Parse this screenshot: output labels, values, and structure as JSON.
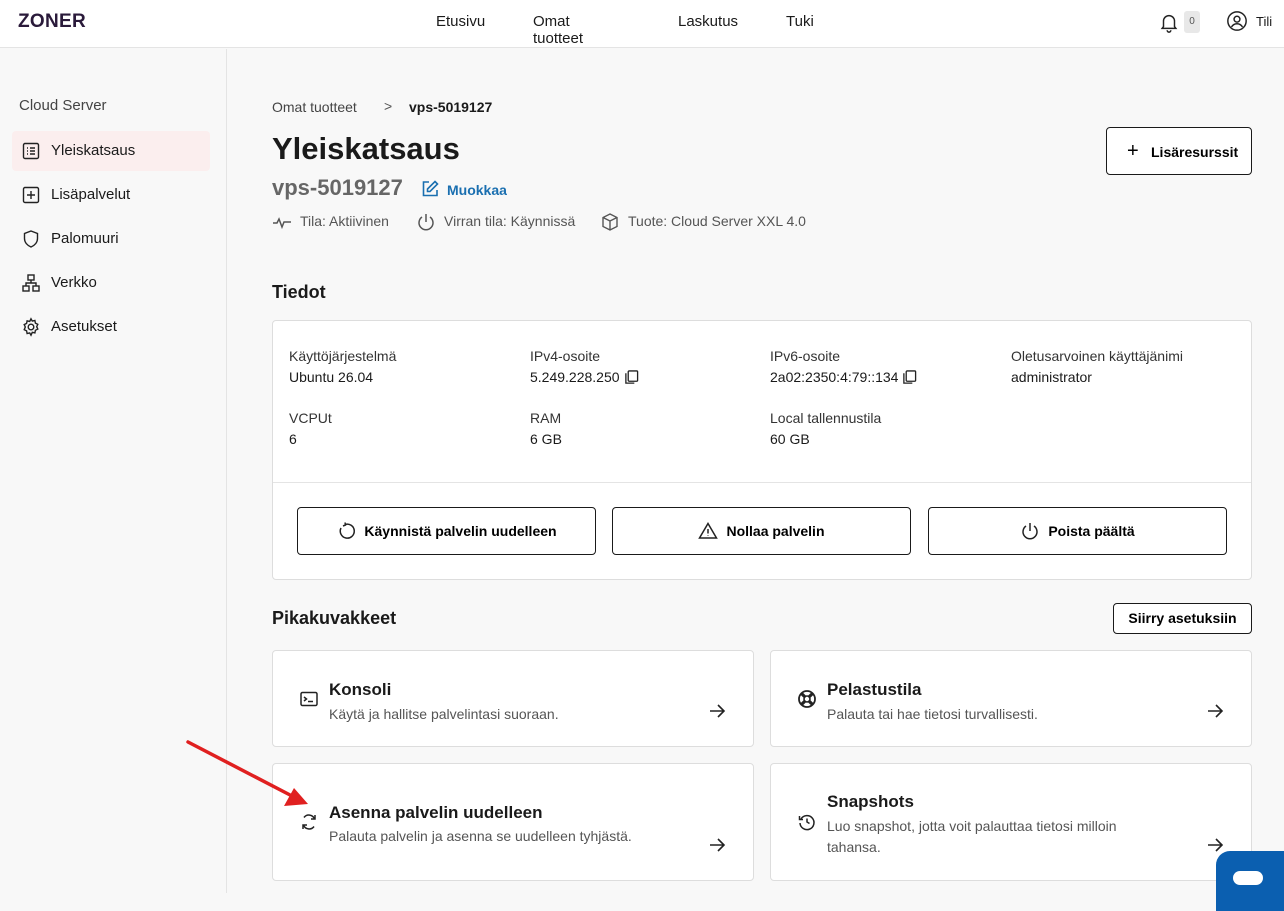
{
  "header": {
    "logo": "ZONER",
    "nav": [
      "Etusivu",
      "Omat tuotteet",
      "Laskutus",
      "Tuki"
    ],
    "notification_count": "0",
    "account_label": "Tili"
  },
  "sidebar": {
    "title": "Cloud Server",
    "items": [
      {
        "label": "Yleiskatsaus",
        "icon": "overview-list-icon",
        "active": true
      },
      {
        "label": "Lisäpalvelut",
        "icon": "plus-square-icon",
        "active": false
      },
      {
        "label": "Palomuuri",
        "icon": "shield-icon",
        "active": false
      },
      {
        "label": "Verkko",
        "icon": "network-icon",
        "active": false
      },
      {
        "label": "Asetukset",
        "icon": "gear-icon",
        "active": false
      }
    ]
  },
  "breadcrumb": {
    "parent": "Omat tuotteet",
    "separator": ">",
    "current": "vps-5019127"
  },
  "page": {
    "title": "Yleiskatsaus",
    "server_name": "vps-5019127",
    "edit_label": "Muokkaa",
    "status": {
      "state": "Tila: Aktiivinen",
      "power": "Virran tila: Käynnissä",
      "product": "Tuote: Cloud Server XXL 4.0"
    },
    "add_resources_label": "Lisäresurssit"
  },
  "details": {
    "heading": "Tiedot",
    "fields": [
      {
        "key": "Käyttöjärjestelmä",
        "value": "Ubuntu 26.04",
        "copy": false
      },
      {
        "key": "IPv4-osoite",
        "value": "5.249.228.250",
        "copy": true
      },
      {
        "key": "IPv6-osoite",
        "value": "2a02:2350:4:79::134",
        "copy": true
      },
      {
        "key": "Oletusarvoinen käyttäjänimi",
        "value": "administrator",
        "copy": false
      },
      {
        "key": "VCPUt",
        "value": "6",
        "copy": false
      },
      {
        "key": "RAM",
        "value": "6 GB",
        "copy": false
      },
      {
        "key": "Local tallennustila",
        "value": "60 GB",
        "copy": false
      }
    ],
    "actions": [
      {
        "label": "Käynnistä palvelin uudelleen",
        "icon": "restart-icon"
      },
      {
        "label": "Nollaa palvelin",
        "icon": "warning-icon"
      },
      {
        "label": "Poista päältä",
        "icon": "power-icon"
      }
    ]
  },
  "shortcuts": {
    "heading": "Pikakuvakkeet",
    "goto_settings_label": "Siirry asetuksiin",
    "cards": [
      {
        "title": "Konsoli",
        "desc": "Käytä ja hallitse palvelintasi suoraan.",
        "icon": "terminal-icon"
      },
      {
        "title": "Pelastustila",
        "desc": "Palauta tai hae tietosi turvallisesti.",
        "icon": "lifebuoy-icon"
      },
      {
        "title": "Asenna palvelin uudelleen",
        "desc": "Palauta palvelin ja asenna se uudelleen tyhjästä.",
        "icon": "reinstall-icon"
      },
      {
        "title": "Snapshots",
        "desc": "Luo snapshot, jotta voit palauttaa tietosi milloin tahansa.",
        "icon": "history-icon"
      }
    ]
  },
  "colors": {
    "accent_link": "#1a6fb0",
    "active_bg": "#fbeeee",
    "annotation_arrow": "#e02020",
    "chat_button": "#0b5fb0"
  }
}
